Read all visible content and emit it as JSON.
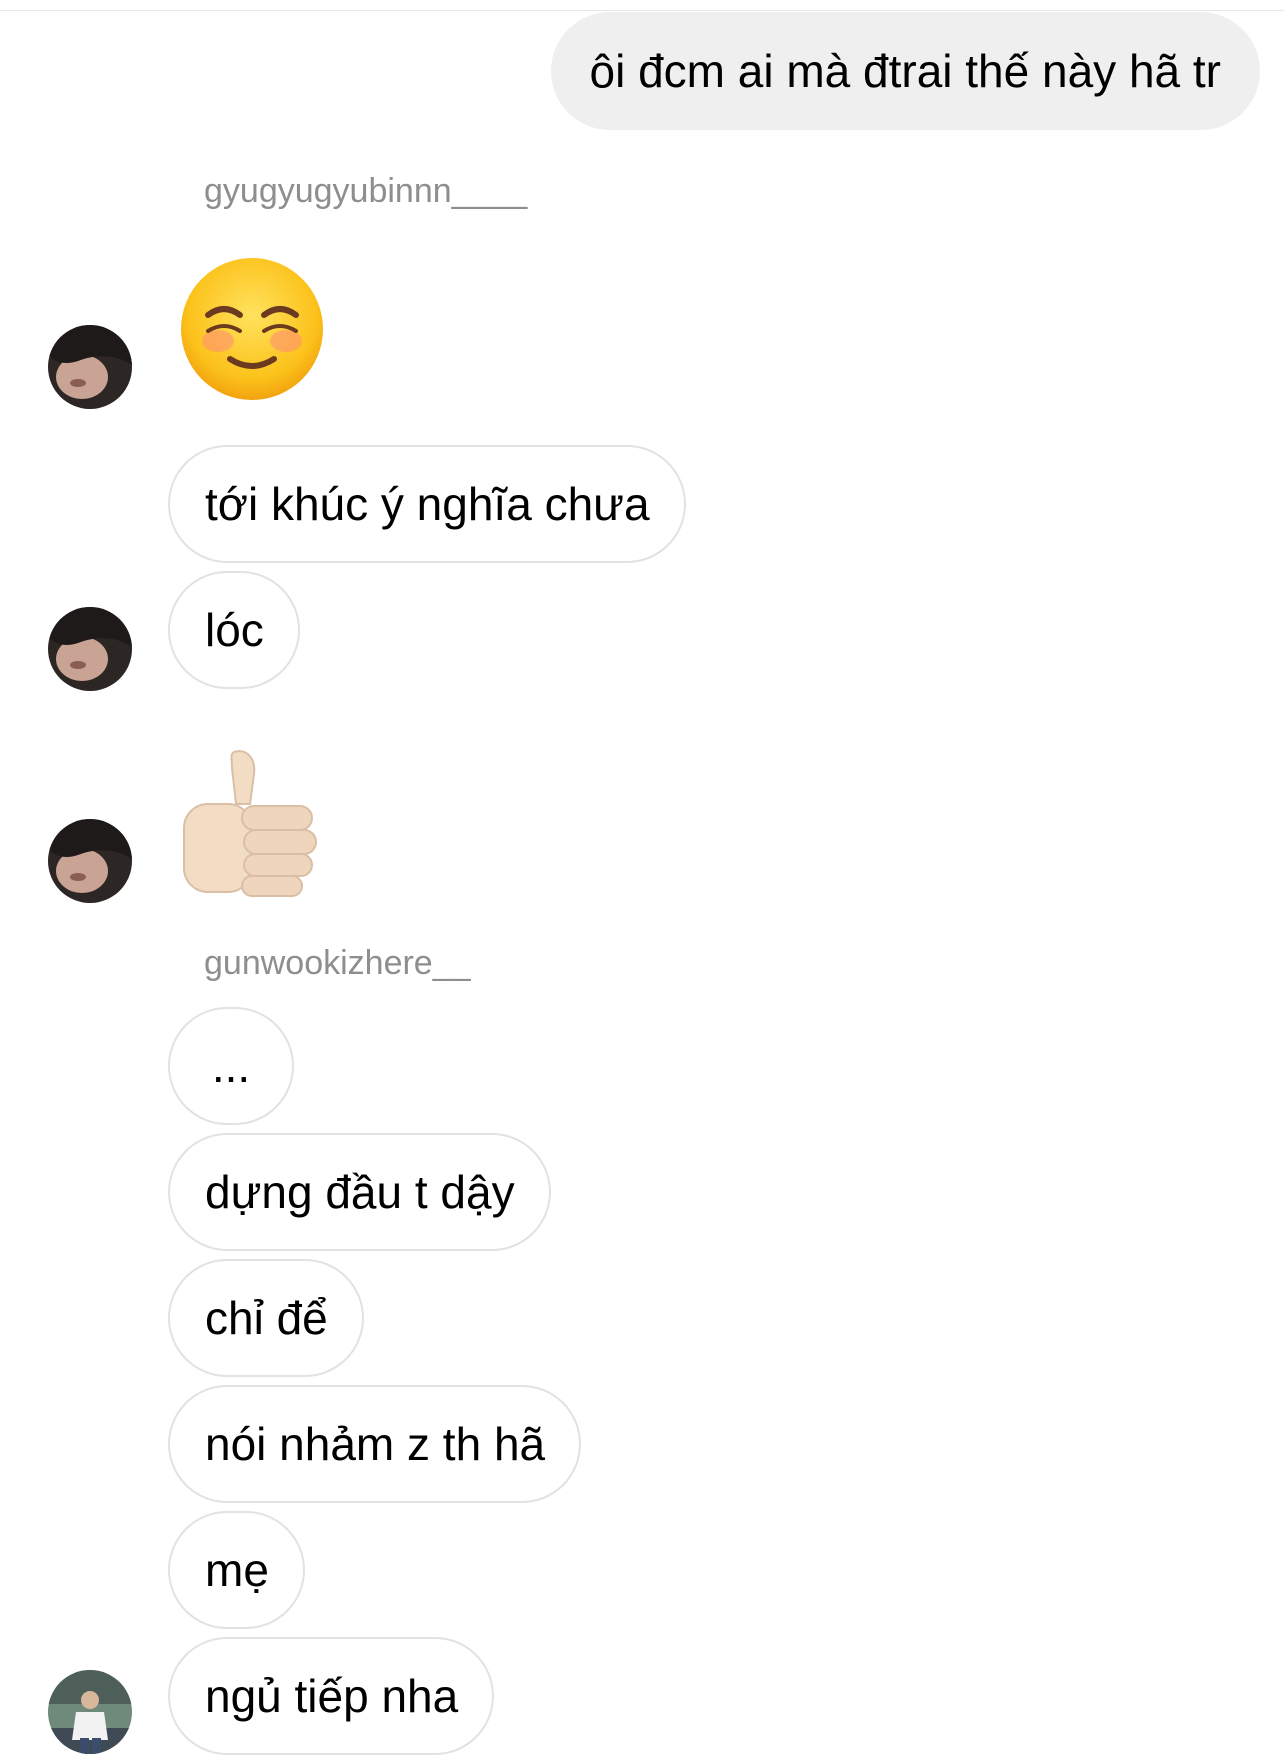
{
  "conversation": {
    "sent_message": "ôi đcm ai mà đtrai thế này hã tr",
    "groups": [
      {
        "sender": "gyugyugyubinnn____",
        "messages": [
          {
            "type": "emoji",
            "icon": "smiling-face-icon"
          },
          {
            "type": "text",
            "text": "tới khúc ý nghĩa chưa"
          },
          {
            "type": "text",
            "text": "lóc"
          },
          {
            "type": "emoji",
            "icon": "thumbs-up-icon"
          }
        ]
      },
      {
        "sender": "gunwookizhere__",
        "messages": [
          {
            "type": "text",
            "text": "..."
          },
          {
            "type": "text",
            "text": "dựng đầu t dậy"
          },
          {
            "type": "text",
            "text": "chỉ để"
          },
          {
            "type": "text",
            "text": "nói nhảm z th hã"
          },
          {
            "type": "text",
            "text": "mẹ"
          },
          {
            "type": "text",
            "text": "ngủ tiếp nha"
          }
        ]
      }
    ]
  },
  "colors": {
    "sent_bubble": "#efefef",
    "received_border": "#e2e2e2",
    "sender_name": "#8e8e8e"
  }
}
